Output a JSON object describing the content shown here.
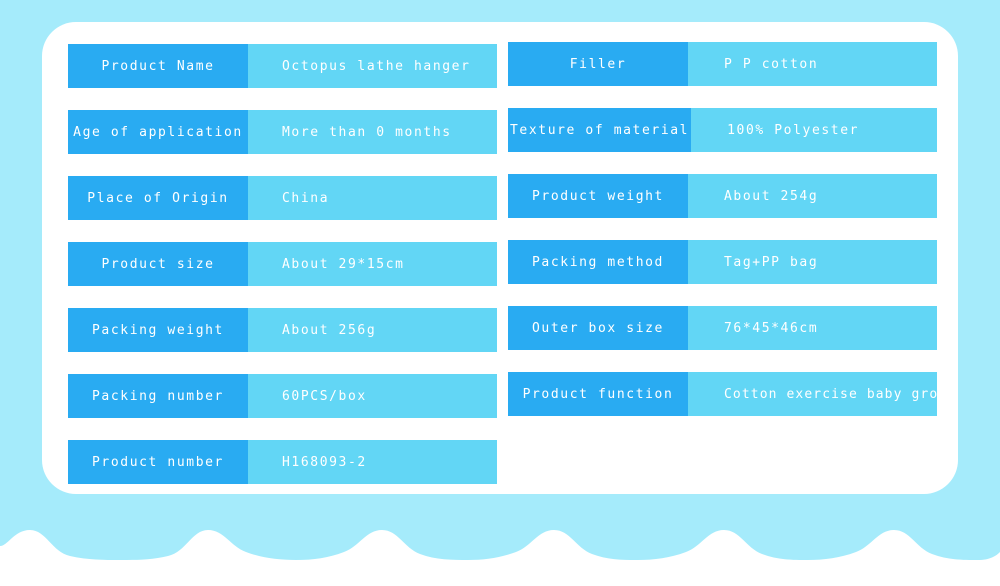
{
  "theme": {
    "page_background": "#a5ebfb",
    "card_background": "#ffffff",
    "label_color": "#29abf2",
    "value_color": "#62d6f5",
    "text_color": "#ffffff"
  },
  "spec_table": {
    "left_column": [
      {
        "label": "Product Name",
        "value": "Octopus lathe hanger"
      },
      {
        "label": "Age of application",
        "value": "More than 0 months"
      },
      {
        "label": "Place of Origin",
        "value": "China"
      },
      {
        "label": "Product size",
        "value": "About 29*15cm"
      },
      {
        "label": "Packing weight",
        "value": "About 256g"
      },
      {
        "label": "Packing number",
        "value": "60PCS/box"
      },
      {
        "label": "Product number",
        "value": "H168093-2"
      }
    ],
    "right_column": [
      {
        "label": "Filler",
        "value": "P P cotton"
      },
      {
        "label": "Texture of material",
        "value": "100% Polyester"
      },
      {
        "label": "Product weight",
        "value": "About 254g"
      },
      {
        "label": "Packing method",
        "value": "Tag+PP bag"
      },
      {
        "label": "Outer box size",
        "value": "76*45*46cm"
      },
      {
        "label": "Product function",
        "value": "Cotton exercise baby growth"
      }
    ]
  }
}
